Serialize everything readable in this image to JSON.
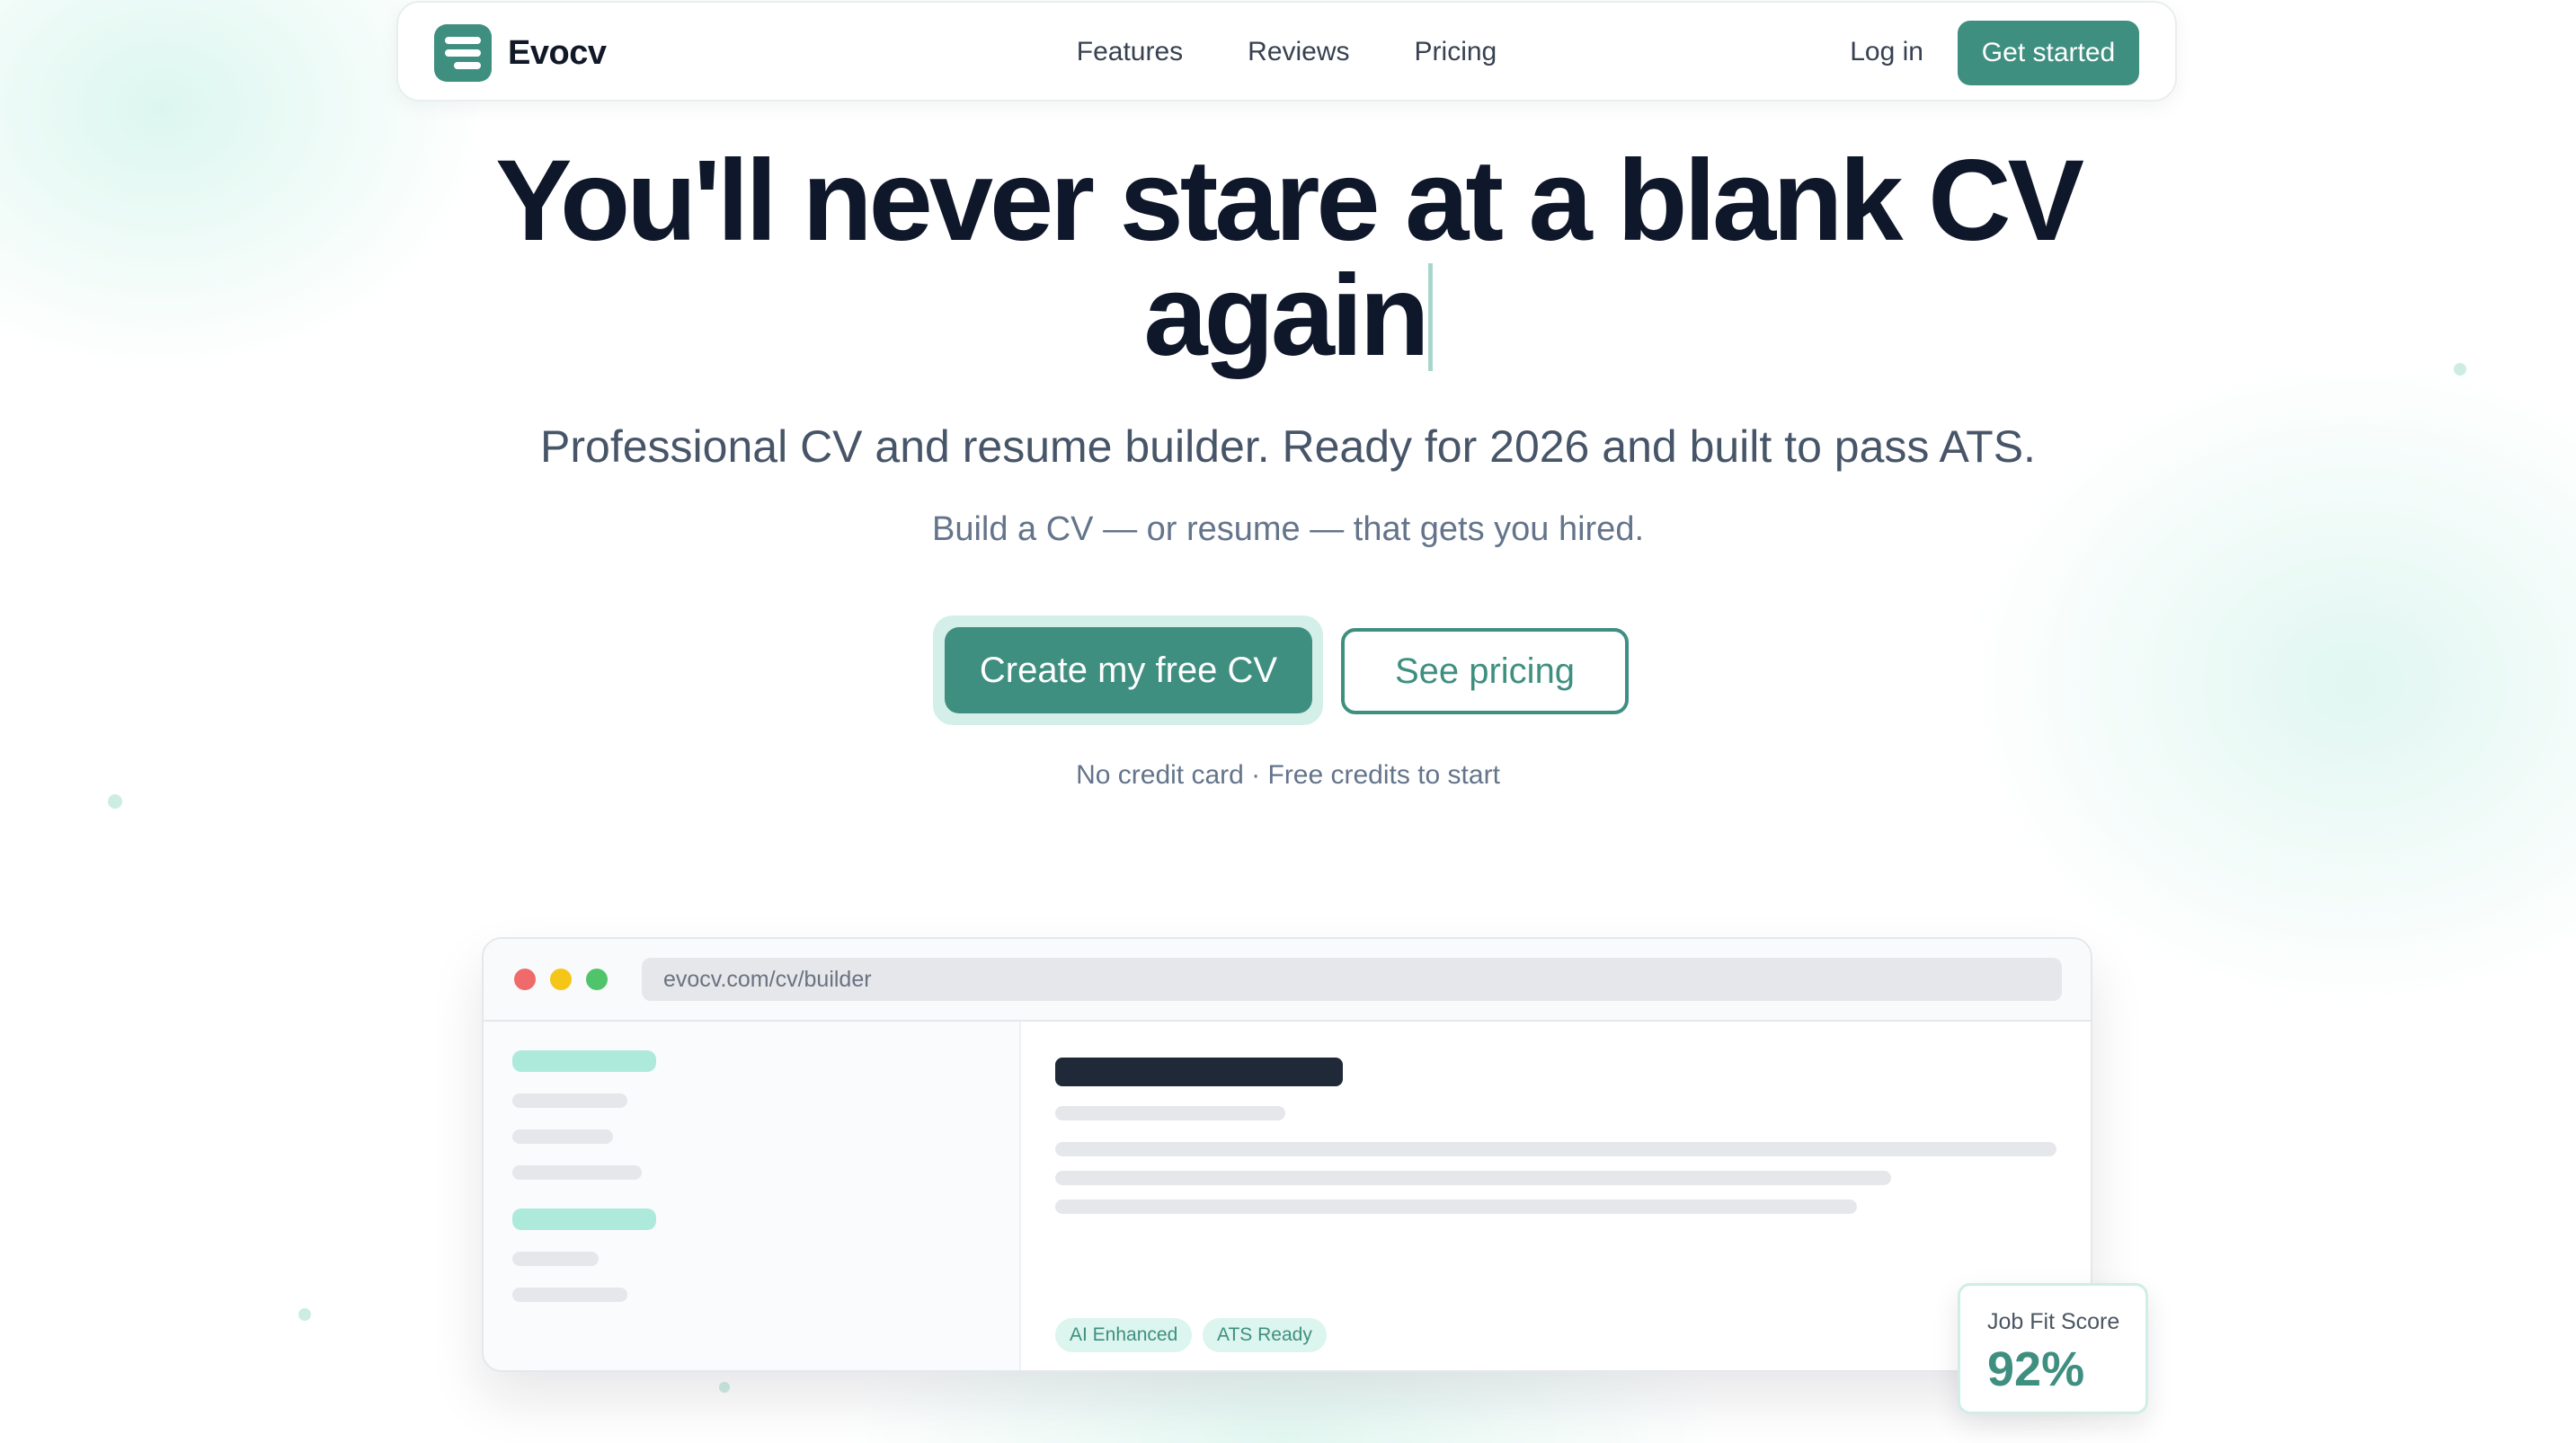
{
  "nav": {
    "brand": "Evocv",
    "links": [
      "Features",
      "Reviews",
      "Pricing"
    ],
    "login": "Log in",
    "cta": "Get started"
  },
  "hero": {
    "title_line1": "You'll never stare at a blank CV",
    "title_line2": "again",
    "subtitle": "Professional CV and resume builder. Ready for 2026 and built to pass ATS.",
    "tagline": "Build a CV — or resume — that gets you hired.",
    "primary_cta": "Create my free CV",
    "secondary_cta": "See pricing",
    "note": "No credit card · Free credits to start"
  },
  "mockup": {
    "url": "evocv.com/cv/builder",
    "badges": [
      "AI Enhanced",
      "ATS Ready"
    ]
  },
  "score_card": {
    "label": "Job Fit Score",
    "value": "92%"
  },
  "colors": {
    "accent": "#3f8f80",
    "accent_soft": "#dcf5ee",
    "heading": "#0f172a",
    "muted": "#64748b"
  },
  "icons": {
    "brand": "stacked-lines-logo-icon",
    "window_controls": [
      "close-dot-icon",
      "minimize-dot-icon",
      "maximize-dot-icon"
    ]
  }
}
